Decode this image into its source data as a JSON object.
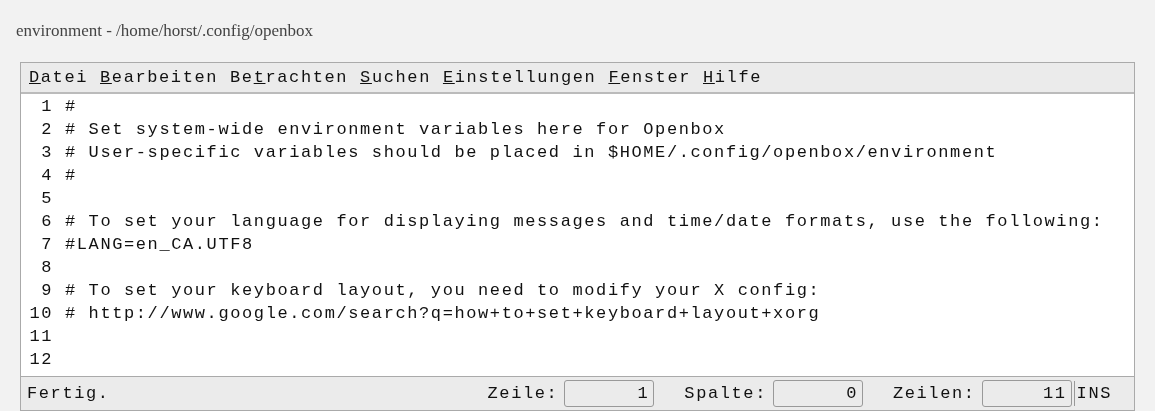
{
  "window": {
    "title": "environment - /home/horst/.config/openbox"
  },
  "menu": [
    {
      "key": "D",
      "post": "atei"
    },
    {
      "key": "B",
      "post": "earbeiten"
    },
    {
      "pre": "Be",
      "key": "t",
      "post": "rachten"
    },
    {
      "key": "S",
      "post": "uchen"
    },
    {
      "key": "E",
      "post": "instellungen"
    },
    {
      "key": "F",
      "post": "enster"
    },
    {
      "key": "H",
      "post": "ilfe"
    }
  ],
  "lines": [
    {
      "number": "1",
      "text": "#"
    },
    {
      "number": "2",
      "text": "# Set system-wide environment variables here for Openbox"
    },
    {
      "number": "3",
      "text": "# User-specific variables should be placed in $HOME/.config/openbox/environment"
    },
    {
      "number": "4",
      "text": "#"
    },
    {
      "number": "5"
    },
    {
      "number": "6",
      "text": "# To set your language for displaying messages and time/date formats, use the following:"
    },
    {
      "number": "7",
      "text": "#LANG=en_CA.UTF8"
    },
    {
      "number": "8"
    },
    {
      "number": "9",
      "text": "# To set your keyboard layout, you need to modify your X config:"
    },
    {
      "number": "10",
      "text": "# http://www.google.com/search?q=how+to+set+keyboard+layout+xorg"
    },
    {
      "number": "11"
    },
    {
      "number": "12"
    }
  ],
  "status_bar": {
    "message": "Fertig.",
    "fields": [
      {
        "label": "Zeile:",
        "value": "1"
      },
      {
        "label": "Spalte:",
        "value": "0"
      },
      {
        "label": "Zeilen:",
        "value": "11"
      }
    ],
    "mode": "INS"
  }
}
